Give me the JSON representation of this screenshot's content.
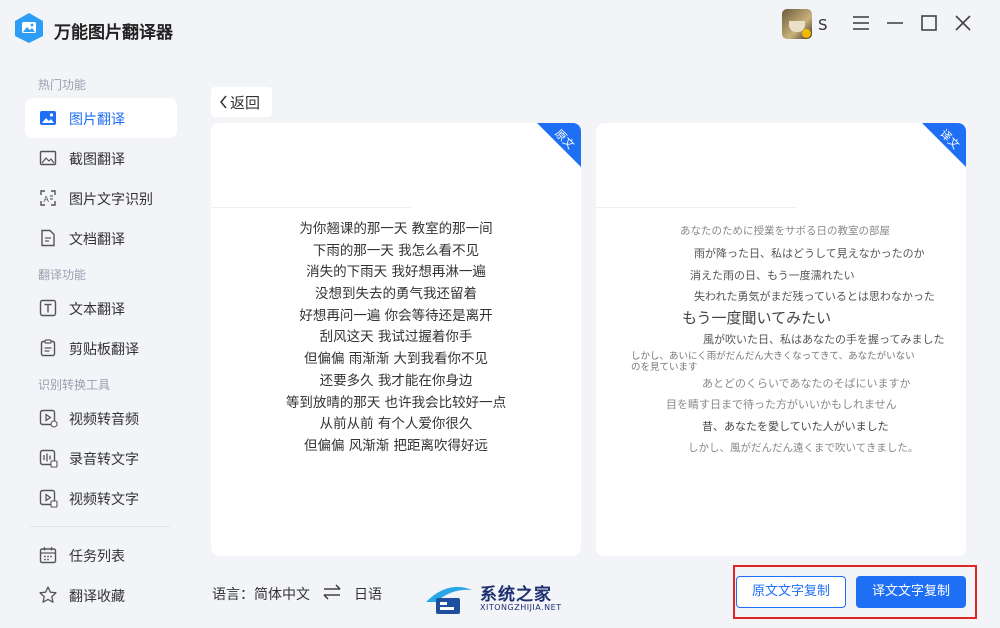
{
  "app": {
    "title": "万能图片翻译器",
    "user_name": "S"
  },
  "colors": {
    "accent": "#1f6ff5",
    "highlight_border": "#e02424",
    "background": "#f3f4f8"
  },
  "sidebar": {
    "sections": [
      {
        "label": "热门功能"
      },
      {
        "label": "翻译功能"
      },
      {
        "label": "识别转换工具"
      }
    ],
    "items": [
      {
        "label": "图片翻译",
        "icon": "image-icon",
        "active": true
      },
      {
        "label": "截图翻译",
        "icon": "screenshot-icon"
      },
      {
        "label": "图片文字识别",
        "icon": "ocr-icon"
      },
      {
        "label": "文档翻译",
        "icon": "document-icon"
      },
      {
        "label": "文本翻译",
        "icon": "text-icon"
      },
      {
        "label": "剪贴板翻译",
        "icon": "clipboard-icon"
      },
      {
        "label": "视频转音频",
        "icon": "video-audio-icon"
      },
      {
        "label": "录音转文字",
        "icon": "recording-icon"
      },
      {
        "label": "视频转文字",
        "icon": "video-text-icon"
      },
      {
        "label": "任务列表",
        "icon": "calendar-icon"
      },
      {
        "label": "翻译收藏",
        "icon": "star-icon"
      }
    ]
  },
  "main": {
    "back_label": "返回",
    "source_panel": {
      "corner_label": "原文",
      "lines": [
        "为你翘课的那一天 教室的那一间",
        "下雨的那一天 我怎么看不见",
        "消失的下雨天 我好想再淋一遍",
        "没想到失去的勇气我还留着",
        "好想再问一遍 你会等待还是离开",
        "刮风这天 我试过握着你手",
        "但偏偏 雨渐渐 大到我看你不见",
        "还要多久 我才能在你身边",
        "等到放晴的那天 也许我会比较好一点",
        "从前从前 有个人爱你很久",
        "但偏偏 风渐渐 把距离吹得好远"
      ]
    },
    "target_panel": {
      "corner_label": "译文",
      "lines": [
        "あなたのために授業をサボる日の教室の部屋",
        "雨が降った日、私はどうして見えなかったのか",
        "消えた雨の日、もう一度濡れたい",
        "失われた勇気がまだ残っているとは思わなかった",
        "もう一度聞いてみたい",
        "風が吹いた日、私はあなたの手を握ってみました",
        "しかし、あいにく雨がだんだん大きくなってきて、あなたがいない",
        "のを見ています",
        "あとどのくらいであなたのそばにいますか",
        "目を睛す日まで待った方がいいかもしれません",
        "昔、あなたを愛していた人がいました",
        "しかし、風がだんだん遠くまで吹いてきました。"
      ]
    }
  },
  "footer": {
    "language_label": "语言：简体中文",
    "target_language": "日语",
    "copy_source_button": "原文文字复制",
    "copy_translation_button": "译文文字复制"
  },
  "watermark": {
    "main": "系统之家",
    "sub": "XITONGZHIJIA.NET"
  }
}
